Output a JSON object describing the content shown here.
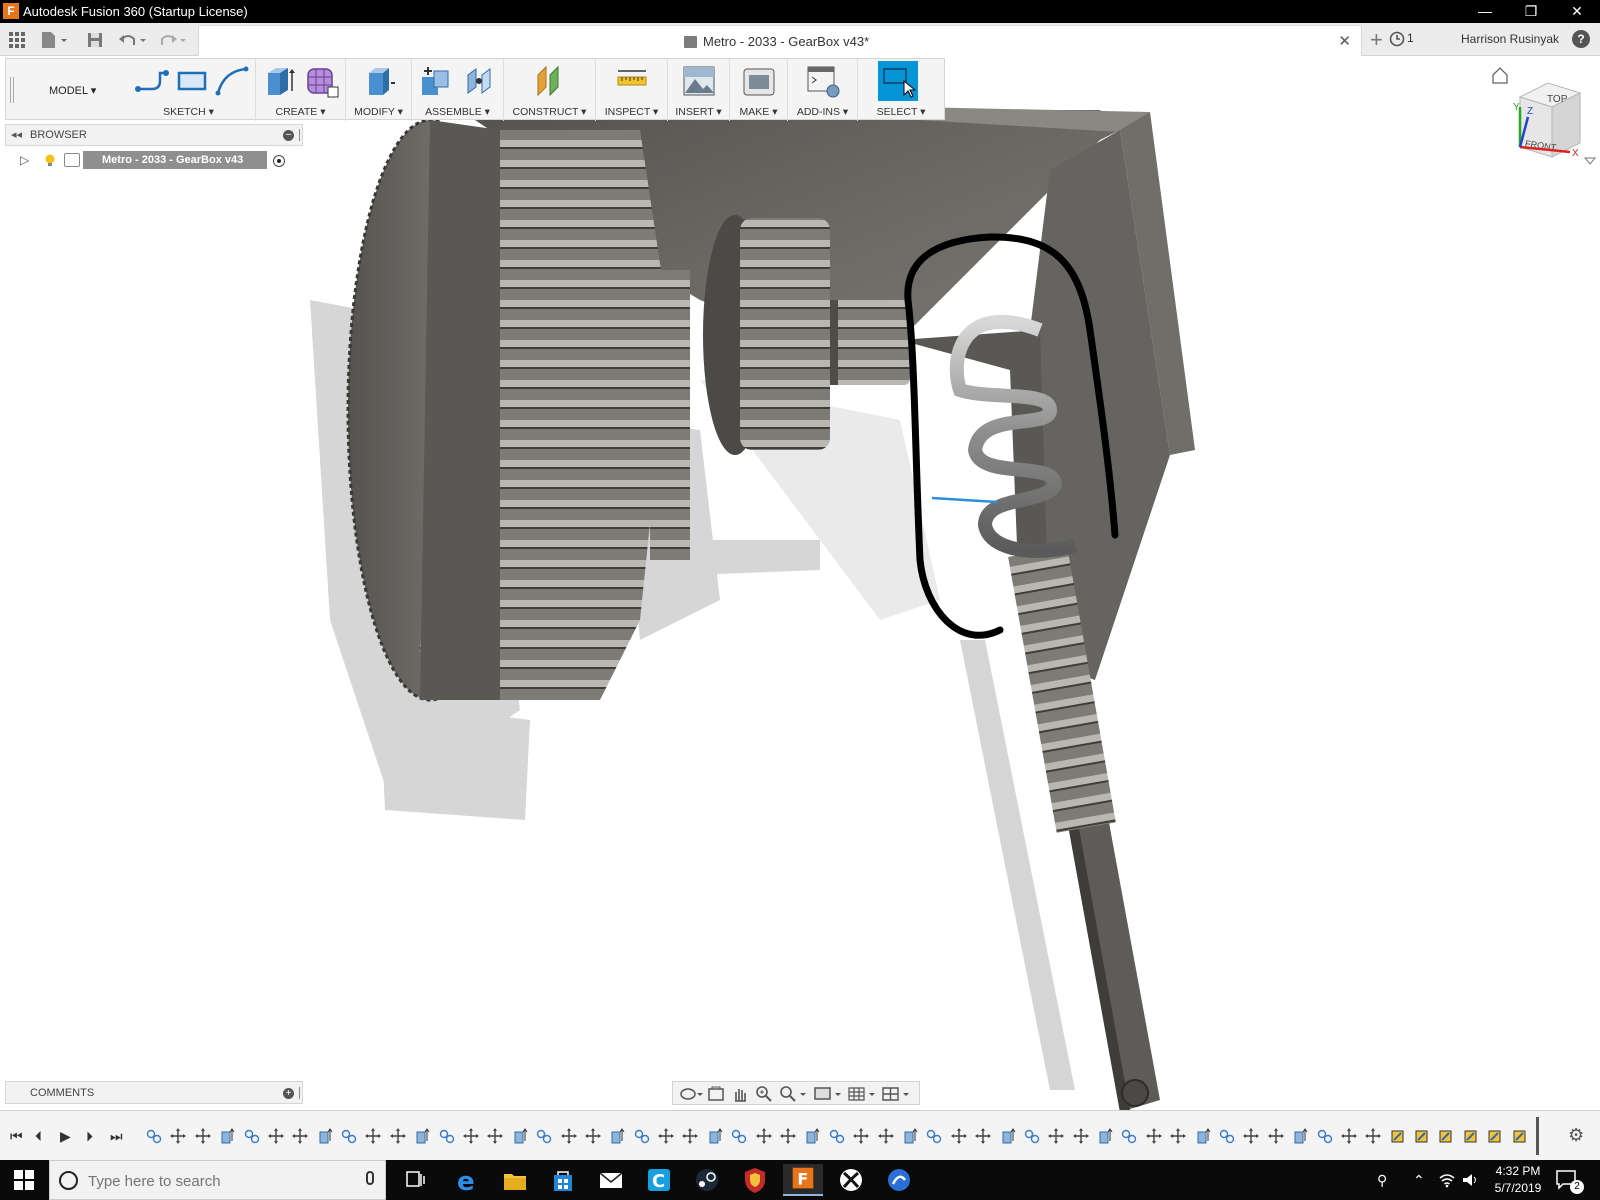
{
  "window": {
    "title": "Autodesk Fusion 360 (Startup License)",
    "app_icon_letter": "F",
    "minimize": "—",
    "restore": "❐",
    "close": "✕"
  },
  "header": {
    "doc_title": "Metro - 2033 - GearBox v43*",
    "jobs_count": "1",
    "user_name": "Harrison Rusinyak",
    "help": "?"
  },
  "toolbar": {
    "workspace": "MODEL ▾",
    "groups": {
      "sketch": "SKETCH ▾",
      "create": "CREATE ▾",
      "modify": "MODIFY ▾",
      "assemble": "ASSEMBLE ▾",
      "construct": "CONSTRUCT ▾",
      "inspect": "INSPECT ▾",
      "insert": "INSERT ▾",
      "make": "MAKE ▾",
      "addins": "ADD-INS ▾",
      "select": "SELECT ▾"
    }
  },
  "browser": {
    "label": "BROWSER",
    "root_item": "Metro - 2033 - GearBox v43"
  },
  "viewcube": {
    "top_label": "TOP",
    "front_label": "FRONT",
    "axis_x": "X",
    "axis_y": "Y",
    "axis_z": "Z"
  },
  "comments": {
    "label": "COMMENTS"
  },
  "taskbar": {
    "search_placeholder": "Type here to search",
    "time": "4:32 PM",
    "date": "5/7/2019",
    "notification_count": "2"
  },
  "colors": {
    "titlebar": "#000000",
    "select_active": "#0696d7",
    "model_gray": "#6b6a66",
    "annotation_stroke": "#000000",
    "sketch_line": "#2b8fe0"
  }
}
